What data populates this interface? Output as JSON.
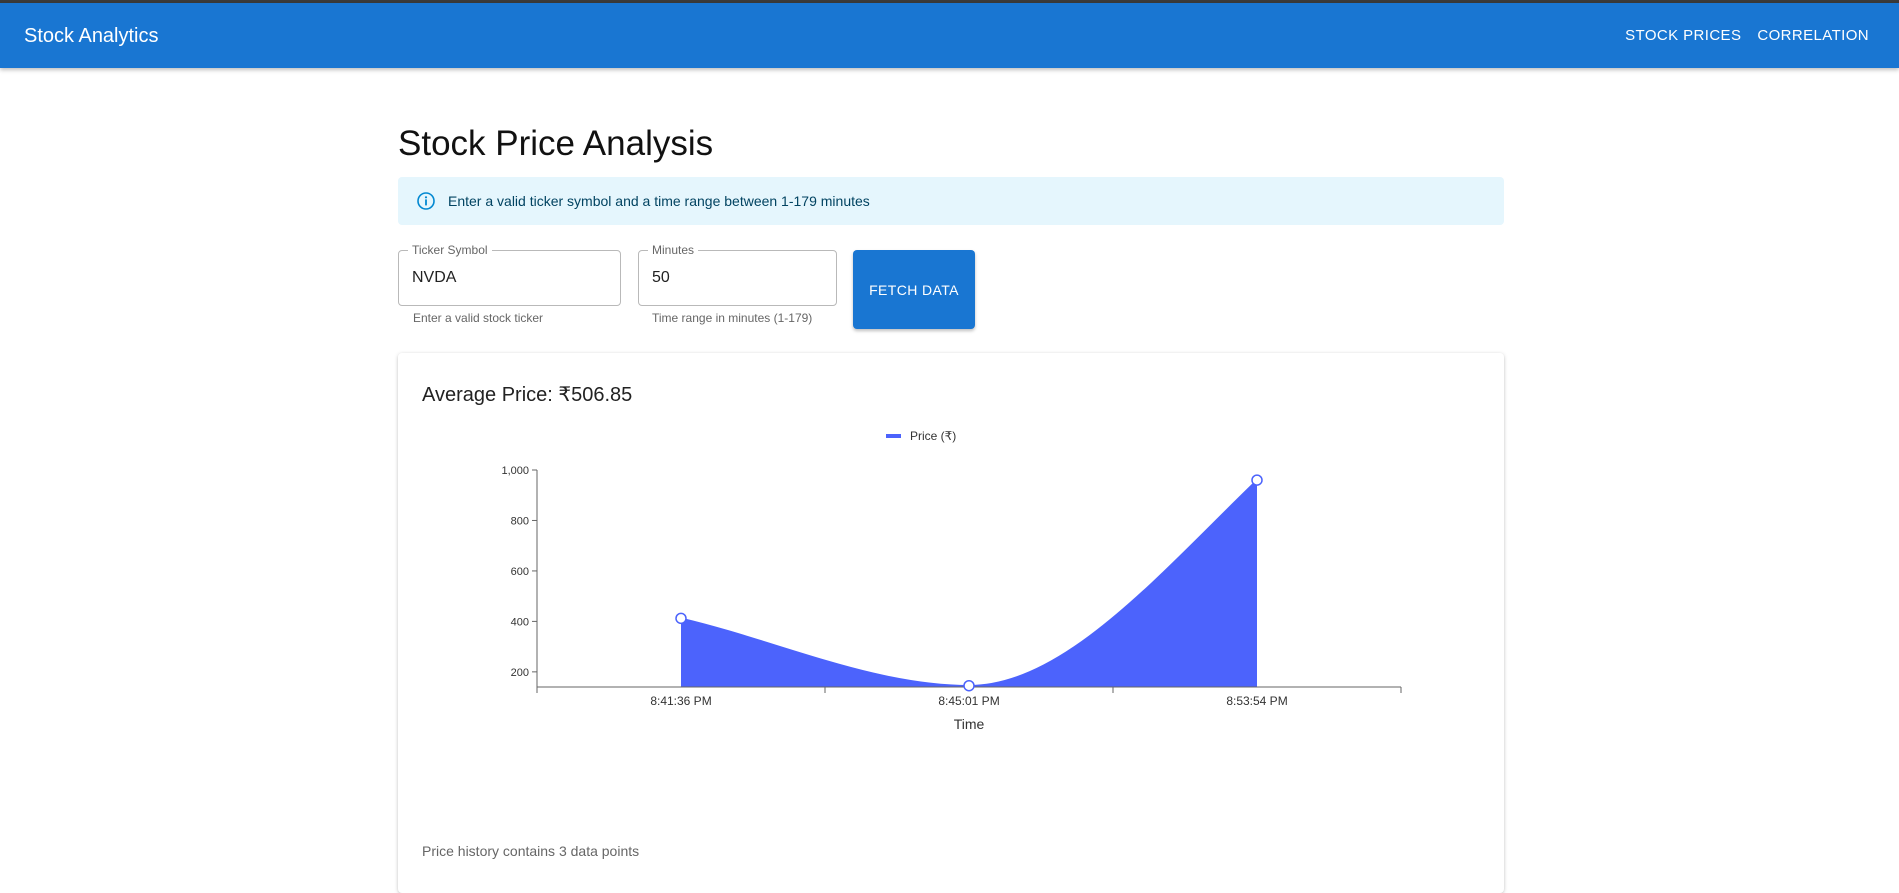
{
  "app": {
    "title": "Stock Analytics",
    "nav": [
      "STOCK PRICES",
      "CORRELATION"
    ]
  },
  "page": {
    "title": "Stock Price Analysis",
    "info": "Enter a valid ticker symbol and a time range between 1-179 minutes"
  },
  "form": {
    "ticker": {
      "label": "Ticker Symbol",
      "value": "NVDA",
      "helper": "Enter a valid stock ticker"
    },
    "minutes": {
      "label": "Minutes",
      "value": "50",
      "helper": "Time range in minutes (1-179)"
    },
    "fetch_label": "FETCH DATA"
  },
  "summary": {
    "average": "Average Price: ₹506.85",
    "history_note": "Price history contains 3 data points"
  },
  "colors": {
    "appbar": "#1976d2",
    "series": "#4c63fc",
    "info_bg": "#e5f6fd"
  },
  "chart_data": {
    "type": "area",
    "legend_position": "top-center",
    "x": [
      "8:41:36 PM",
      "8:45:01 PM",
      "8:53:54 PM"
    ],
    "series": [
      {
        "name": "Price (₹)",
        "values": [
          412,
          145,
          960
        ]
      }
    ],
    "xlabel": "Time",
    "ylabel": "",
    "yticks": [
      "200",
      "400",
      "600",
      "800",
      "1,000"
    ],
    "ytick_values": [
      200,
      400,
      600,
      800,
      1000
    ],
    "ylim": [
      140,
      1000
    ],
    "x_ticks_at_points": true,
    "grid": false
  }
}
